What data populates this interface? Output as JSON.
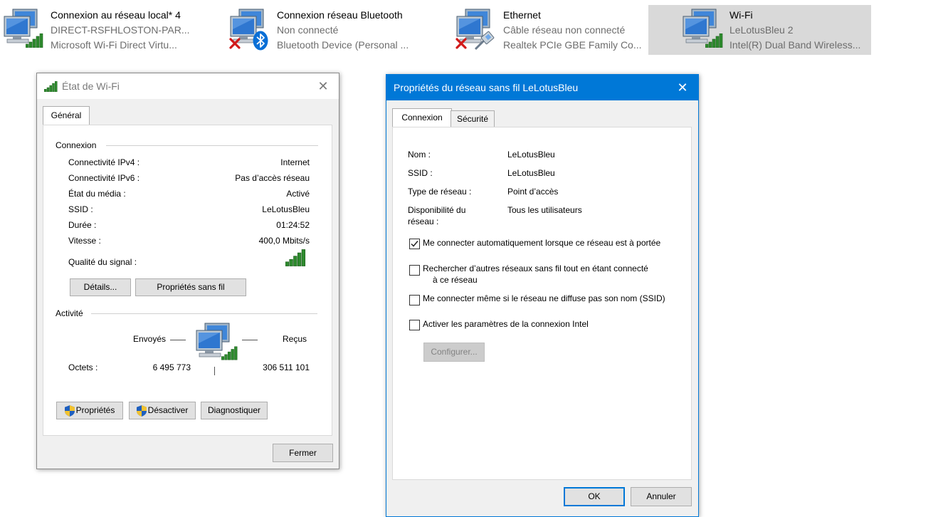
{
  "connections": [
    {
      "name": "Connexion au réseau local* 4",
      "status": "DIRECT-RSFHLOSTON-PAR...",
      "device": "Microsoft Wi-Fi Direct Virtu...",
      "badge": "signal"
    },
    {
      "name": "Connexion réseau Bluetooth",
      "status": "Non connecté",
      "device": "Bluetooth Device (Personal ...",
      "badge": "bluetooth"
    },
    {
      "name": "Ethernet",
      "status": "Câble réseau non connecté",
      "device": "Realtek PCIe GBE Family Co...",
      "badge": "cable"
    },
    {
      "name": "Wi-Fi",
      "status": "LeLotusBleu  2",
      "device": "Intel(R) Dual Band Wireless...",
      "badge": "signal",
      "selected": true
    }
  ],
  "wifi_status": {
    "title": "État de Wi-Fi",
    "tab_general": "Général",
    "section_connexion": "Connexion",
    "rows": [
      {
        "label": "Connectivité IPv4 :",
        "value": "Internet"
      },
      {
        "label": "Connectivité IPv6 :",
        "value": "Pas d’accès réseau"
      },
      {
        "label": "État du média :",
        "value": "Activé"
      },
      {
        "label": "SSID :",
        "value": "LeLotusBleu"
      },
      {
        "label": "Durée :",
        "value": "01:24:52"
      },
      {
        "label": "Vitesse :",
        "value": "400,0 Mbits/s"
      }
    ],
    "signal_label": "Qualité du signal :",
    "details_button": "Détails...",
    "wireless_props_button": "Propriétés sans fil",
    "section_activite": "Activité",
    "sent_label": "Envoyés",
    "received_label": "Reçus",
    "bytes_label": "Octets :",
    "bytes_sent": "6 495 773",
    "bytes_received": "306 511 101",
    "properties_button": "Propriétés",
    "disable_button": "Désactiver",
    "diagnose_button": "Diagnostiquer",
    "close_button": "Fermer"
  },
  "wireless_props": {
    "title": "Propriétés du réseau sans fil LeLotusBleu",
    "tab_connexion": "Connexion",
    "tab_securite": "Sécurité",
    "rows": [
      {
        "label": "Nom :",
        "value": "LeLotusBleu"
      },
      {
        "label": "SSID :",
        "value": "LeLotusBleu"
      },
      {
        "label": "Type de réseau :",
        "value": "Point d’accès"
      }
    ],
    "availability_label_1": "Disponibilité du",
    "availability_label_2": "réseau :",
    "availability_value": "Tous les utilisateurs",
    "checkboxes": [
      {
        "line1": "Me connecter automatiquement lorsque ce réseau est à portée",
        "line2": "",
        "checked": true
      },
      {
        "line1": "Rechercher d’autres réseaux sans fil tout en étant connecté",
        "line2": "à ce réseau",
        "checked": false
      },
      {
        "line1": "Me connecter même si le réseau ne diffuse pas son nom (SSID)",
        "line2": "",
        "checked": false
      },
      {
        "line1": "Activer les paramètres de la connexion Intel",
        "line2": "",
        "checked": false
      }
    ],
    "configure_button": "Configurer...",
    "ok_button": "OK",
    "cancel_button": "Annuler"
  },
  "colors": {
    "titlebar_active": "#0078d7",
    "selection": "#d9d9d9",
    "signal_green": "#2e8b2e",
    "error_red": "#d11a1a",
    "bluetooth_blue": "#0a6fd6"
  }
}
